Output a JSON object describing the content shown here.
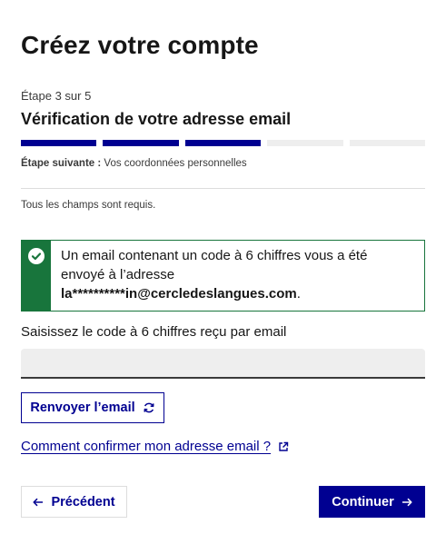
{
  "page": {
    "title": "Créez votre compte"
  },
  "stepper": {
    "count": "Étape 3 sur 5",
    "current_title": "Vérification de votre adresse email",
    "next_label": "Étape suivante :",
    "next_value": "Vos coordonnées personnelles",
    "total_steps": 5,
    "completed_steps": 3,
    "color_done": "#000091",
    "color_todo": "#eeeeee"
  },
  "form": {
    "required_note": "Tous les champs sont requis.",
    "alert": {
      "text_before": "Un email contenant un code à 6 chiffres vous a été envoyé à l’adresse",
      "email": "la**********in@cercledeslangues.com",
      "text_after": ".",
      "icon": "check-circle-icon",
      "color": "#18753c"
    },
    "code_label": "Saisissez le code à 6 chiffres reçu par email",
    "code_value": "",
    "code_placeholder": "",
    "resend_label": "Renvoyer l’email",
    "help_link": "Comment confirmer mon adresse email ?"
  },
  "nav": {
    "prev_label": "Précédent",
    "next_label": "Continuer",
    "accent": "#000091"
  }
}
